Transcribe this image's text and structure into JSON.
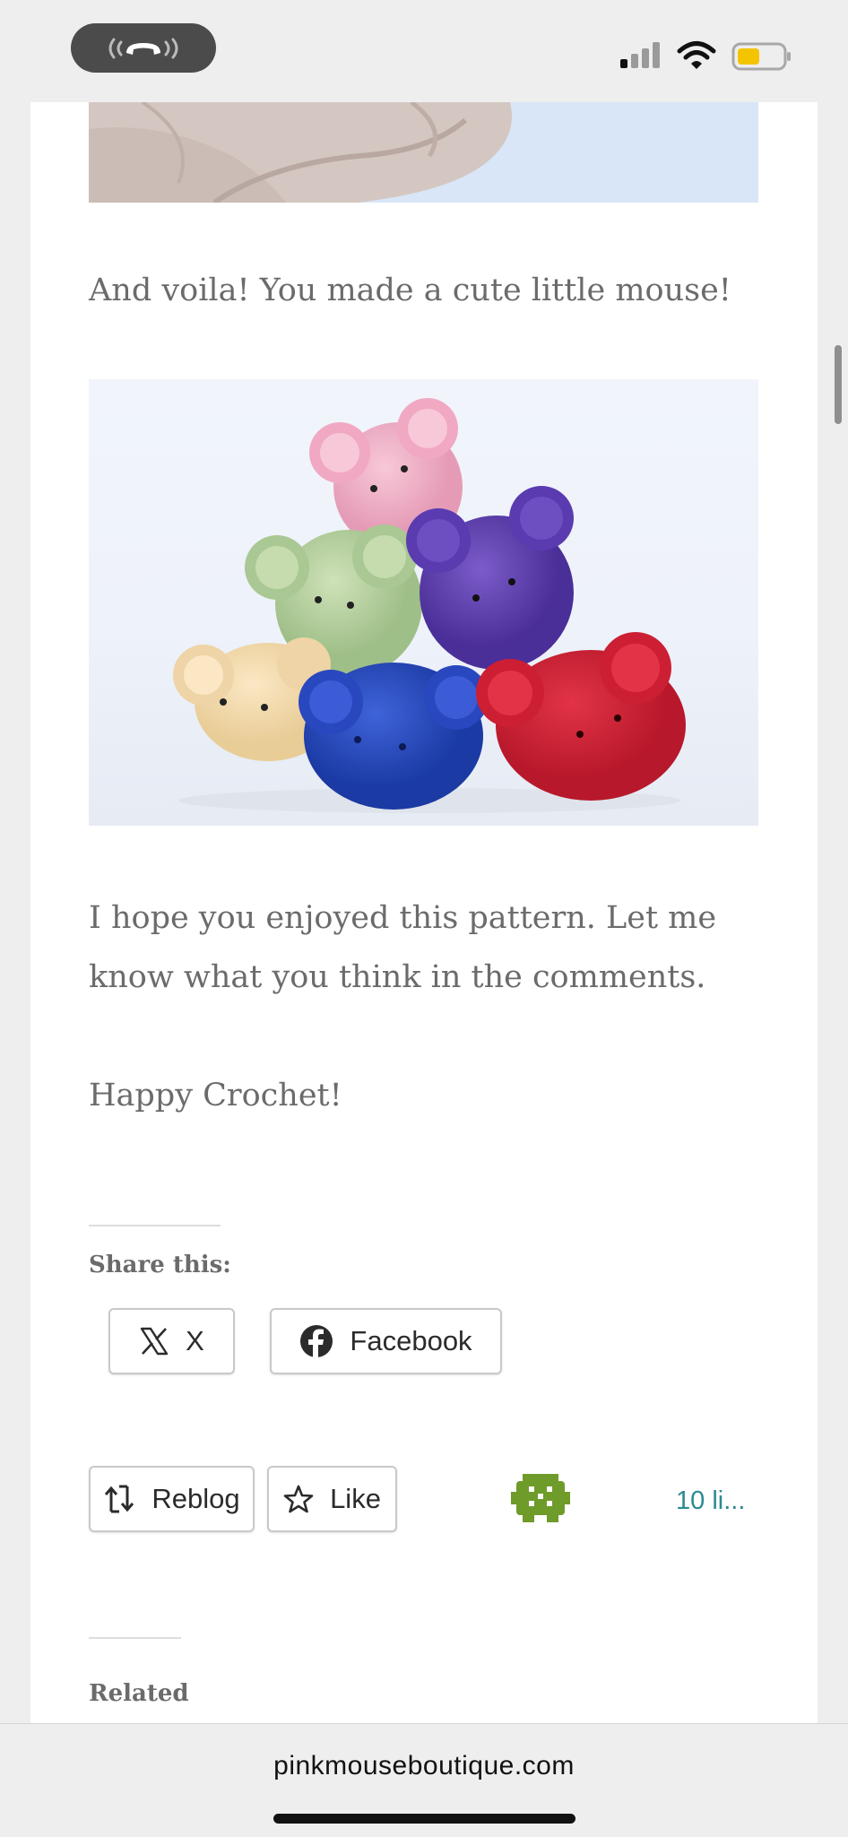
{
  "browser": {
    "url": "pinkmouseboutique.com"
  },
  "article": {
    "paragraph_voila": "And voila! You made a cute little mouse!",
    "paragraph_hope": "I hope you enjoyed this pattern. Let me know what you think in the comments.",
    "paragraph_happy": "Happy Crochet!"
  },
  "share": {
    "title": "Share this:",
    "x_label": "X",
    "facebook_label": "Facebook"
  },
  "like_bar": {
    "reblog_label": "Reblog",
    "like_label": "Like",
    "likes_text": "10 li..."
  },
  "related": {
    "title": "Related"
  },
  "icons": {
    "call": "phone-call-icon",
    "signal": "cellular-signal-icon",
    "wifi": "wifi-icon",
    "battery": "battery-icon",
    "x": "x-logo-icon",
    "facebook": "facebook-logo-icon",
    "reblog": "reblog-icon",
    "like": "star-icon",
    "avatar": "green-avatar-icon"
  },
  "colors": {
    "likes_link": "#2a8a92",
    "battery_fill": "#f5c400",
    "avatar_green": "#6f9b2a"
  }
}
